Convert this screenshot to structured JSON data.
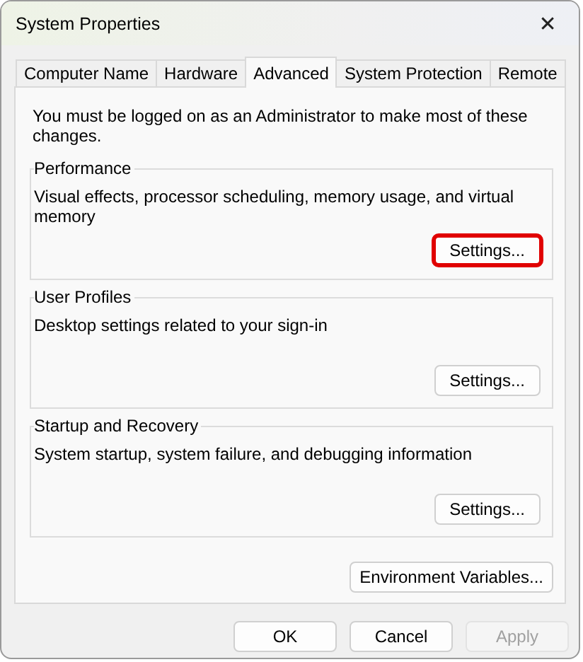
{
  "window": {
    "title": "System Properties",
    "close": "✕"
  },
  "tabs": [
    {
      "label": "Computer Name",
      "selected": false
    },
    {
      "label": "Hardware",
      "selected": false
    },
    {
      "label": "Advanced",
      "selected": true
    },
    {
      "label": "System Protection",
      "selected": false
    },
    {
      "label": "Remote",
      "selected": false
    }
  ],
  "notice": "You must be logged on as an Administrator to make most of these changes.",
  "groups": [
    {
      "title": "Performance",
      "description": "Visual effects, processor scheduling, memory usage, and virtual memory",
      "button": "Settings...",
      "highlighted": true
    },
    {
      "title": "User Profiles",
      "description": "Desktop settings related to your sign-in",
      "button": "Settings...",
      "highlighted": false
    },
    {
      "title": "Startup and Recovery",
      "description": "System startup, system failure, and debugging information",
      "button": "Settings...",
      "highlighted": false
    }
  ],
  "environment_button": "Environment Variables...",
  "buttons": [
    {
      "label": "OK",
      "disabled": false
    },
    {
      "label": "Cancel",
      "disabled": false
    },
    {
      "label": "Apply",
      "disabled": true
    }
  ]
}
